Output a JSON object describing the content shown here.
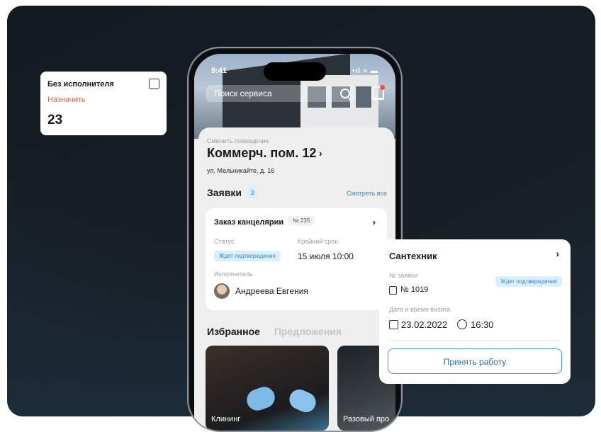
{
  "phone": {
    "status": {
      "time": "9:41",
      "icons": "•ıl ≈ ▬"
    },
    "search": {
      "placeholder": "Поиск сервиса"
    },
    "room": {
      "hint": "Сменить помещение",
      "title": "Коммерч. пом. 12",
      "address": "ул. Мельникайте, д. 16"
    },
    "requests": {
      "title": "Заявки",
      "count": "3",
      "see_all": "Смотреть все",
      "card": {
        "title": "Заказ канцелярии",
        "number": "№ 235",
        "status_label": "Статус",
        "status_value": "Ждет подтверждения",
        "deadline_label": "Крайний срок",
        "deadline_value": "15 июля  10:00",
        "executor_label": "Исполнитель",
        "executor_name": "Андреева Евгения"
      }
    },
    "tabs": {
      "active": "Избранное",
      "inactive": "Предложения"
    },
    "services": [
      {
        "label": "Клининг"
      },
      {
        "label": "Разовый про"
      }
    ]
  },
  "left_card": {
    "title": "Без исполнителя",
    "action": "Назначить",
    "count": "23"
  },
  "right_card": {
    "title": "Сантехник",
    "number_label": "№ заявки",
    "number_value": "№ 1019",
    "status_badge": "Ждет подтверждения",
    "datetime_label": "Дата и время визита",
    "date_value": "23.02.2022",
    "time_value": "16:30",
    "button": "Принять работу"
  },
  "colors": {
    "accent": "#2a8ad8",
    "danger": "#ef5d52",
    "badge_bg": "#dbeefc"
  }
}
